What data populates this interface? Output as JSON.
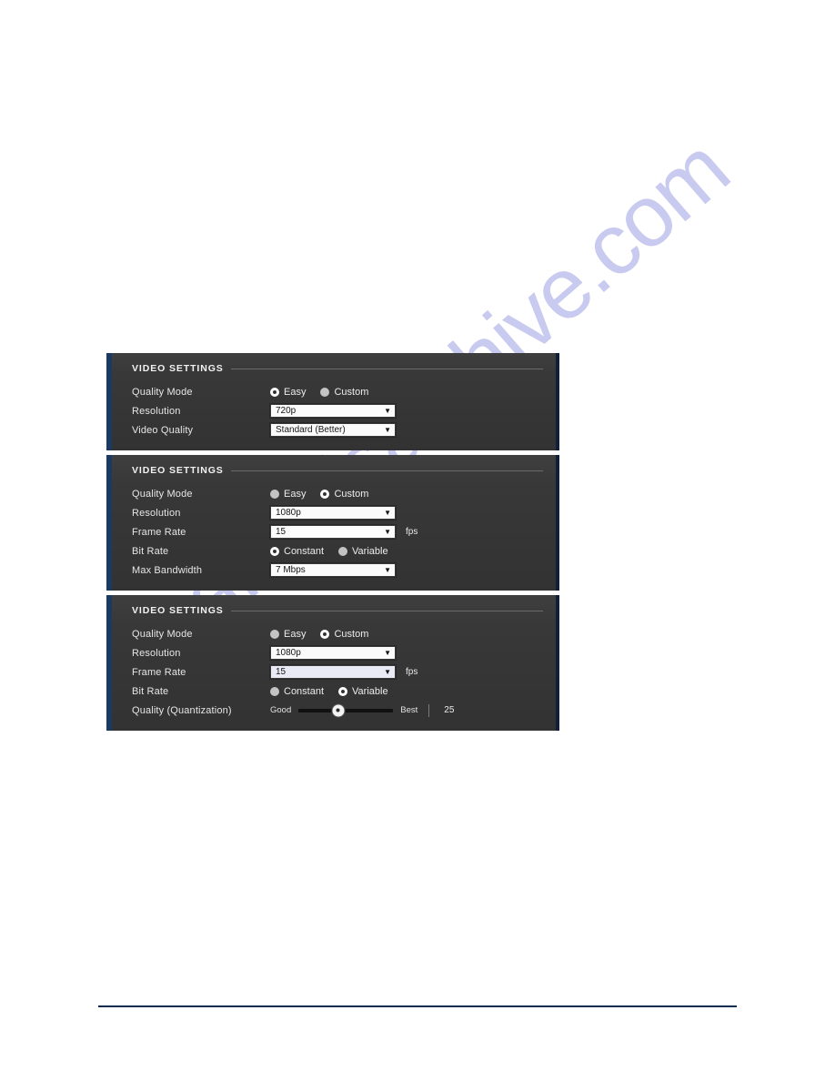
{
  "document": {
    "watermark_text": "manualsarchive.com",
    "watermark_color": "#c9caf0",
    "footer_rule_color": "#0d2b51",
    "panel_bg_color": "#383838",
    "panel_accent_color": "#1b3a63"
  },
  "panels": [
    {
      "title": "VIDEO SETTINGS",
      "rows": [
        {
          "label": "Quality Mode",
          "type": "radio",
          "options": [
            {
              "label": "Easy",
              "selected": true
            },
            {
              "label": "Custom",
              "selected": false
            }
          ]
        },
        {
          "label": "Resolution",
          "type": "select",
          "value": "720p",
          "arrow": "▼",
          "unit": ""
        },
        {
          "label": "Video Quality",
          "type": "select",
          "value": "Standard (Better)",
          "arrow": "▼",
          "unit": ""
        }
      ]
    },
    {
      "title": "VIDEO SETTINGS",
      "rows": [
        {
          "label": "Quality Mode",
          "type": "radio",
          "options": [
            {
              "label": "Easy",
              "selected": false
            },
            {
              "label": "Custom",
              "selected": true
            }
          ]
        },
        {
          "label": "Resolution",
          "type": "select",
          "value": "1080p",
          "arrow": "▼",
          "unit": ""
        },
        {
          "label": "Frame Rate",
          "type": "select",
          "value": "15",
          "arrow": "▼",
          "unit": "fps"
        },
        {
          "label": "Bit Rate",
          "type": "radio",
          "options": [
            {
              "label": "Constant",
              "selected": true
            },
            {
              "label": "Variable",
              "selected": false
            }
          ]
        },
        {
          "label": "Max Bandwidth",
          "type": "select",
          "value": "7 Mbps",
          "arrow": "▼",
          "unit": ""
        }
      ]
    },
    {
      "title": "VIDEO SETTINGS",
      "rows": [
        {
          "label": "Quality Mode",
          "type": "radio",
          "options": [
            {
              "label": "Easy",
              "selected": false
            },
            {
              "label": "Custom",
              "selected": true
            }
          ]
        },
        {
          "label": "Resolution",
          "type": "select",
          "value": "1080p",
          "arrow": "▼",
          "unit": ""
        },
        {
          "label": "Frame Rate",
          "type": "select",
          "value": "15",
          "arrow": "▼",
          "unit": "fps",
          "tinted": true
        },
        {
          "label": "Bit Rate",
          "type": "radio",
          "options": [
            {
              "label": "Constant",
              "selected": false
            },
            {
              "label": "Variable",
              "selected": true
            }
          ]
        },
        {
          "label": "Quality (Quantization)",
          "type": "slider",
          "min_label": "Good",
          "max_label": "Best",
          "value": "25",
          "knob_percent": 42
        }
      ]
    }
  ]
}
